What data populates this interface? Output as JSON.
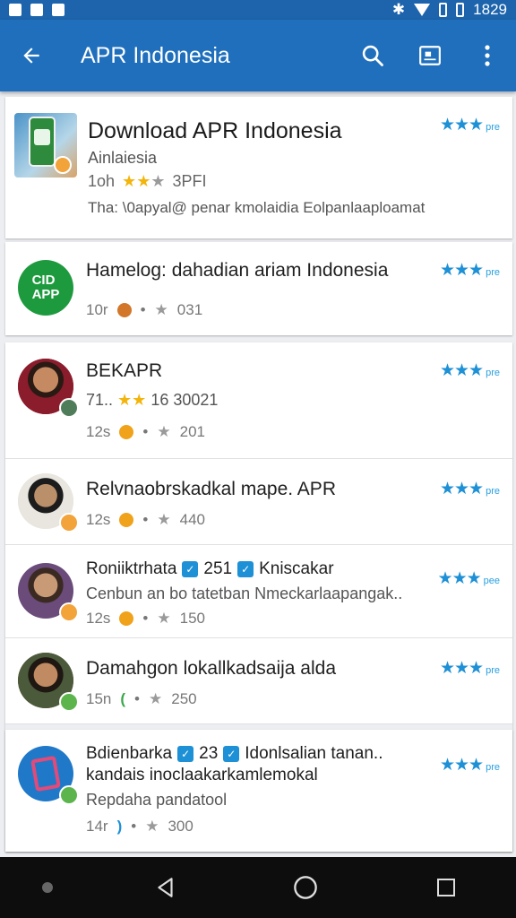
{
  "status_bar": {
    "time": "1829"
  },
  "app_bar": {
    "title": "APR Indonesia"
  },
  "colors": {
    "primary": "#1f6fbd",
    "accent_star": "#1e90d6",
    "badge_orange": "#f2a33a",
    "badge_green": "#5bb54c"
  },
  "header_card": {
    "title": "Download APR Indonesia",
    "subtitle": "Ainlaiesia",
    "meta_count": "1oh",
    "meta_rating": "3PFI",
    "description": "Tha: \\0apyal@ penar kmolaidia  Eolpanlaaploamat",
    "stars_suffix": "pre"
  },
  "items": [
    {
      "title": "Hamelog: dahadian ariam Indonesia",
      "meta_count": "10r",
      "meta_value": "031",
      "stars_suffix": "pre"
    },
    {
      "title": "BEKAPR",
      "subtitle": "71..  ",
      "subtitle_value": "16  30021",
      "meta_count": "12s",
      "meta_value": "201",
      "stars_suffix": "pre"
    },
    {
      "title": "Relvnaobrskadkal mape. APR",
      "meta_count": "12s",
      "meta_value": "440",
      "stars_suffix": "pre"
    },
    {
      "title": "Roniiktrhata",
      "title_num": "251",
      "title_tail": "Kniscakar",
      "subtitle": "Cenbun an bo tatetban Nmeckarlaapangak..",
      "meta_count": "12s",
      "meta_value": "150",
      "stars_suffix": "pee"
    },
    {
      "title": "Damahgon lokallkadsaija alda",
      "meta_count": "15n",
      "meta_value": "250",
      "stars_suffix": "pre"
    },
    {
      "title": "Bdienbarka",
      "title_num": "23",
      "title_tail": "Idonlsalian tanan..",
      "title_line2": "kandais inoclaakarkamlemokal",
      "subtitle": "Repdaha pandatool",
      "meta_count": "14r",
      "meta_value": "300",
      "stars_suffix": "pre"
    }
  ]
}
